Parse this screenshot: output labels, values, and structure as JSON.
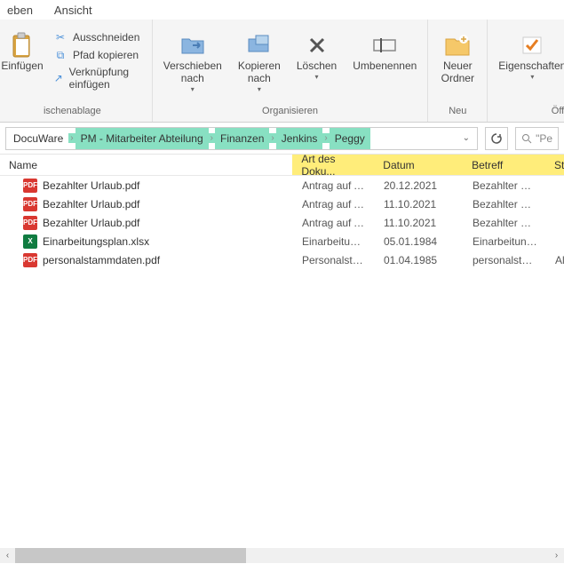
{
  "menu": {
    "items": [
      "eben",
      "Ansicht"
    ]
  },
  "ribbon": {
    "clipboard": {
      "paste": "Einfügen",
      "cut": "Ausschneiden",
      "copy_path": "Pfad kopieren",
      "paste_shortcut": "Verknüpfung einfügen",
      "label": "ischenablage"
    },
    "organize": {
      "move_to": "Verschieben\nnach",
      "copy_to": "Kopieren\nnach",
      "delete": "Löschen",
      "rename": "Umbenennen",
      "label": "Organisieren"
    },
    "new": {
      "new_folder": "Neuer\nOrdner",
      "label": "Neu"
    },
    "open": {
      "properties": "Eigenschaften",
      "label": "Öffn"
    }
  },
  "breadcrumbs": {
    "items": [
      "DocuWare",
      "PM - Mitarbeiter Abteilung",
      "Finanzen",
      "Jenkins",
      "Peggy"
    ],
    "highlight_from": 1
  },
  "search": {
    "placeholder": "\"Pe"
  },
  "columns": {
    "name": "Name",
    "art": "Art des Doku...",
    "datum": "Datum",
    "betreff": "Betreff",
    "st": "St"
  },
  "files": [
    {
      "icon": "pdf",
      "name": "Bezahlter Urlaub.pdf",
      "art": "Antrag auf A...",
      "datum": "20.12.2021",
      "betreff": "Bezahlter Urla...",
      "st": ""
    },
    {
      "icon": "pdf",
      "name": "Bezahlter Urlaub.pdf",
      "art": "Antrag auf A...",
      "datum": "11.10.2021",
      "betreff": "Bezahlter Urla...",
      "st": ""
    },
    {
      "icon": "pdf",
      "name": "Bezahlter Urlaub.pdf",
      "art": "Antrag auf A...",
      "datum": "11.10.2021",
      "betreff": "Bezahlter Urla...",
      "st": ""
    },
    {
      "icon": "xlsx",
      "name": "Einarbeitungsplan.xlsx",
      "art": "Einarbeitungs...",
      "datum": "05.01.1984",
      "betreff": "Einarbeitungs...",
      "st": ""
    },
    {
      "icon": "pdf",
      "name": "personalstammdaten.pdf",
      "art": "Personalstam...",
      "datum": "01.04.1985",
      "betreff": "personalstam...",
      "st": "Al"
    }
  ]
}
